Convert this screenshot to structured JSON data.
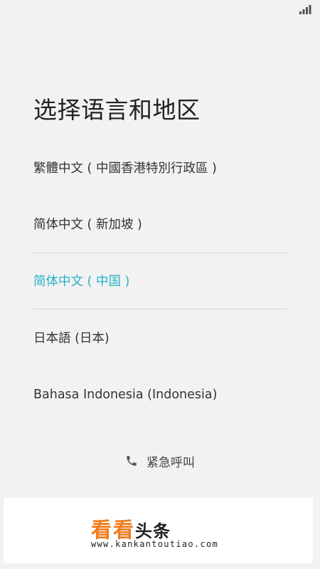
{
  "page": {
    "title": "选择语言和地区"
  },
  "languages": [
    {
      "label": "繁體中文 ( 中國香港特別行政區 )",
      "selected": false
    },
    {
      "label": "简体中文 ( 新加坡 )",
      "selected": false
    },
    {
      "label": "简体中文 ( 中国 )",
      "selected": true
    },
    {
      "label": "日本語 (日本)",
      "selected": false
    },
    {
      "label": "Bahasa Indonesia (Indonesia)",
      "selected": false
    }
  ],
  "emergency": {
    "label": "紧急呼叫",
    "icon": "phone-icon"
  },
  "status_bar": {
    "icon": "signal-icon"
  },
  "watermark": {
    "title_orange": "看看",
    "title_dark": "头条",
    "url": "www.kankantoutiao.com"
  },
  "colors": {
    "accent": "#26b3c5",
    "background": "#f2f2f2",
    "watermark_orange": "#f07b1c"
  }
}
